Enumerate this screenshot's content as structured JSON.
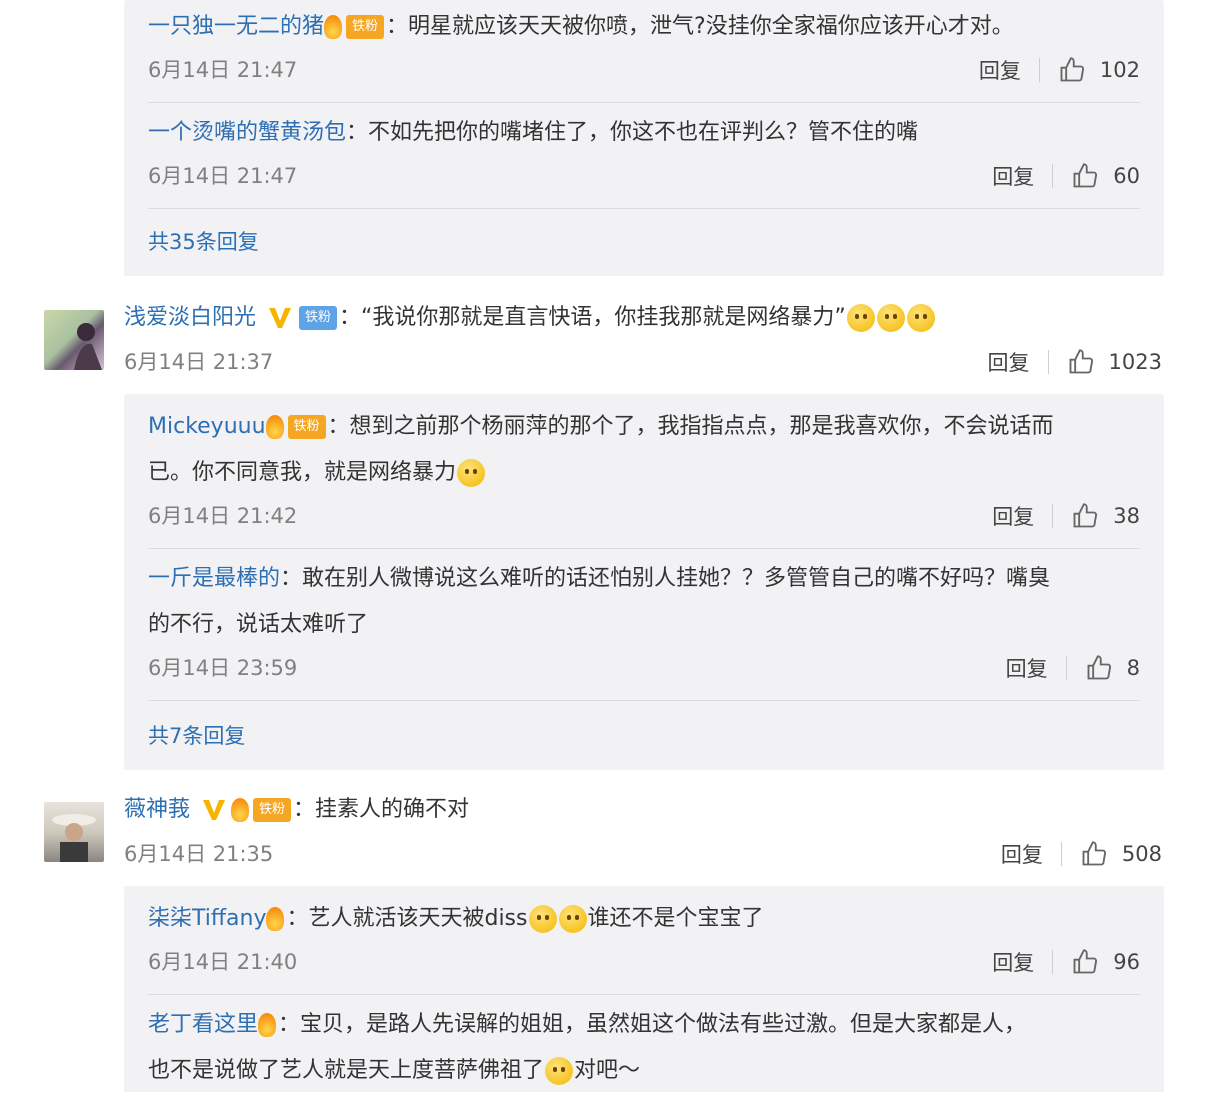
{
  "c1": {
    "r1": {
      "name": "一只独一无二的猪",
      "badge": "铁粉",
      "text": "：明星就应该天天被你喷，泄气?没挂你全家福你应该开心才对。",
      "time": "6月14日 21:47",
      "reply": "回复",
      "likes": "102"
    },
    "r2": {
      "name": "一个烫嘴的蟹黄汤包",
      "text": "：不如先把你的嘴堵住了，你这不也在评判么？管不住的嘴",
      "time": "6月14日 21:47",
      "reply": "回复",
      "likes": "60"
    },
    "more": "共35条回复"
  },
  "c2": {
    "main": {
      "name": "浅爱淡白阳光",
      "badge": "铁粉",
      "text": "：“我说你那就是直言快语，你挂我那就是网络暴力”",
      "time": "6月14日 21:37",
      "reply": "回复",
      "likes": "1023"
    },
    "r1": {
      "name": "Mickeyuuu",
      "badge": "铁粉",
      "text1": "：想到之前那个杨丽萍的那个了，我指指点点，那是我喜欢你，不会说话而",
      "text2": "已。你不同意我，就是网络暴力",
      "time": "6月14日 21:42",
      "reply": "回复",
      "likes": "38"
    },
    "r2": {
      "name": "一斤是最棒的",
      "text1": "：敢在别人微博说这么难听的话还怕别人挂她？？多管管自己的嘴不好吗？嘴臭",
      "text2": "的不行，说话太难听了",
      "time": "6月14日 23:59",
      "reply": "回复",
      "likes": "8"
    },
    "more": "共7条回复"
  },
  "c3": {
    "main": {
      "name": "薇神莪",
      "badge": "铁粉",
      "text": "：挂素人的确不对",
      "time": "6月14日 21:35",
      "reply": "回复",
      "likes": "508"
    },
    "r1": {
      "name": "柒柒Tiffany",
      "text_a": "：艺人就活该天天被diss",
      "text_b": "谁还不是个宝宝了",
      "time": "6月14日 21:40",
      "reply": "回复",
      "likes": "96"
    },
    "r2": {
      "name": "老丁看这里",
      "text1": "：宝贝，是路人先误解的姐姐，虽然姐这个做法有些过激。但是大家都是人，",
      "text2": "也不是说做了艺人就是天上度菩萨佛祖了",
      "text3": "对吧～"
    }
  }
}
